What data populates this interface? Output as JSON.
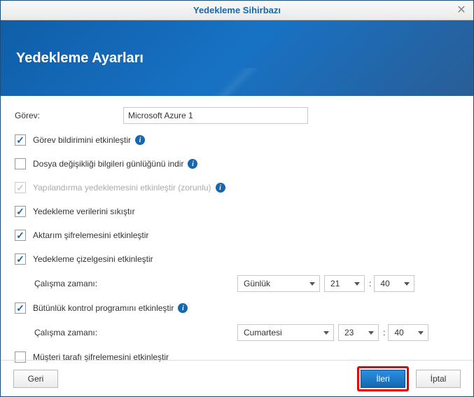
{
  "window": {
    "title": "Yedekleme Sihirbazı"
  },
  "header": {
    "title": "Yedekleme Ayarları"
  },
  "task": {
    "label": "Görev:",
    "value": "Microsoft Azure 1"
  },
  "options": {
    "notification": "Görev bildirimini etkinleştir",
    "filechange": "Dosya değişikliği bilgileri günlüğünü indir",
    "configbackup": "Yapılandırma yedeklemesini etkinleştir (zorunlu)",
    "compress": "Yedekleme verilerini sıkıştır",
    "transferenc": "Aktarım şifrelemesini etkinleştir",
    "schedule": "Yedekleme çizelgesini etkinleştir",
    "runtime1_label": "Çalışma zamanı:",
    "integrity": "Bütünlük kontrol programını etkinleştir",
    "runtime2_label": "Çalışma zamanı:",
    "clientenc": "Müşteri tarafı şifrelemesini etkinleştir"
  },
  "schedule1": {
    "freq": "Günlük",
    "hour": "21",
    "minute": "40"
  },
  "schedule2": {
    "day": "Cumartesi",
    "hour": "23",
    "minute": "40"
  },
  "buttons": {
    "back": "Geri",
    "next": "İleri",
    "cancel": "İptal"
  }
}
